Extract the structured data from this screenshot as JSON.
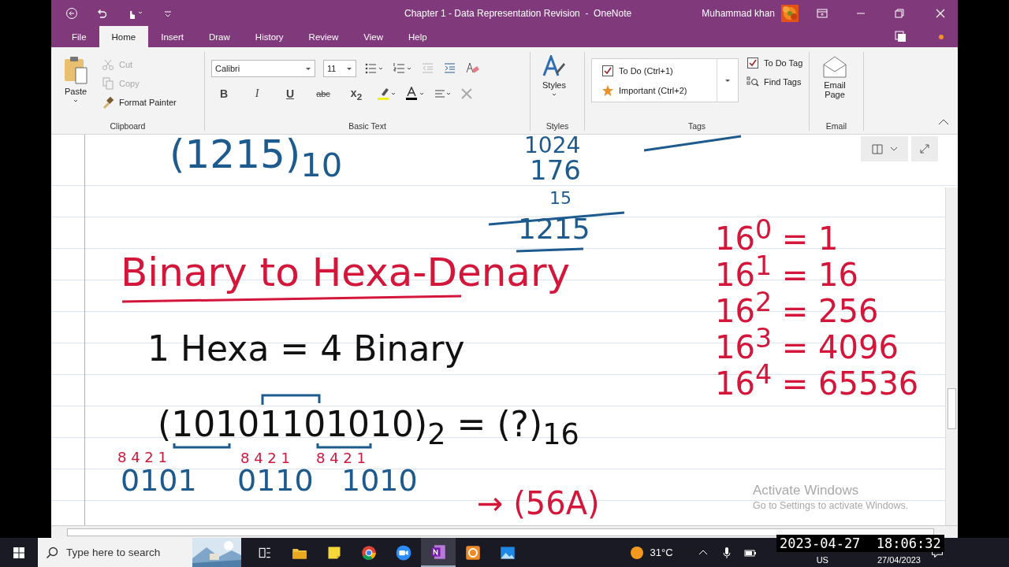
{
  "window": {
    "title": "Chapter 1 - Data Representation Revision  -  OneNote",
    "user": "Muhammad khan"
  },
  "ribbon_tabs": [
    {
      "label": "File",
      "selected": false
    },
    {
      "label": "Home",
      "selected": true
    },
    {
      "label": "Insert",
      "selected": false
    },
    {
      "label": "Draw",
      "selected": false
    },
    {
      "label": "History",
      "selected": false
    },
    {
      "label": "Review",
      "selected": false
    },
    {
      "label": "View",
      "selected": false
    },
    {
      "label": "Help",
      "selected": false
    }
  ],
  "clipboard": {
    "label": "Clipboard",
    "paste": "Paste",
    "items": [
      {
        "kind": "cut",
        "label": "Cut",
        "disabled": true
      },
      {
        "kind": "copy",
        "label": "Copy",
        "disabled": true
      },
      {
        "kind": "painter",
        "label": "Format Painter",
        "disabled": false
      }
    ]
  },
  "basic_text": {
    "label": "Basic Text",
    "font": "Calibri",
    "size": "11",
    "format_buttons": [
      {
        "kind": "bold",
        "label": "B"
      },
      {
        "kind": "italic",
        "label": "I"
      },
      {
        "kind": "underline",
        "label": "U"
      },
      {
        "kind": "strike",
        "label": "abc"
      },
      {
        "kind": "subscript",
        "label": "x$_{2}$"
      }
    ]
  },
  "styles": {
    "label": "Styles",
    "button": "Styles"
  },
  "tags": {
    "label": "Tags",
    "gallery": [
      {
        "kind": "todo",
        "label": "To Do (Ctrl+1)"
      },
      {
        "kind": "important",
        "label": "Important (Ctrl+2)"
      }
    ],
    "todo_tag": "To Do Tag",
    "find_tags": "Find Tags"
  },
  "email": {
    "label": "Email",
    "button": "Email Page"
  },
  "ink": [
    {
      "text": "(1215)$_{10}$",
      "color": "#1d5a8e"
    },
    {
      "text": "1024",
      "color": "#1d5a8e"
    },
    {
      "text": "176",
      "color": "#1d5a8e"
    },
    {
      "text": "15",
      "color": "#1d5a8e"
    },
    {
      "text": "1215",
      "color": "#1d5a8e"
    },
    {
      "text": "Binary to Hexa-Denary",
      "color": "#d4163a"
    },
    {
      "text": "1 Hexa = 4 Binary",
      "color": "#111111"
    },
    {
      "text": "(10101101010)$_{2}$ = (?)$_{16}$",
      "color": "#111111"
    },
    {
      "text": "8 4 2 1",
      "color": "#d4163a"
    },
    {
      "text": "8 4 2 1",
      "color": "#d4163a"
    },
    {
      "text": "8 4 2 1",
      "color": "#d4163a"
    },
    {
      "text": "0101",
      "color": "#1d5a8e"
    },
    {
      "text": "0110",
      "color": "#1d5a8e"
    },
    {
      "text": "1010",
      "color": "#1d5a8e"
    },
    {
      "text": "→ (56A)",
      "color": "#d4163a"
    },
    {
      "text": "16$^{0}$ = 1",
      "color": "#d4163a"
    },
    {
      "text": "16$^{1}$ = 16",
      "color": "#d4163a"
    },
    {
      "text": "16$^{2}$ = 256",
      "color": "#d4163a"
    },
    {
      "text": "16$^{3}$ = 4096",
      "color": "#d4163a"
    },
    {
      "text": "16$^{4}$ = 65536",
      "color": "#d4163a"
    }
  ],
  "activation": {
    "title": "Activate Windows",
    "hint": "Go to Settings to activate Windows."
  },
  "taskbar": {
    "search_placeholder": "Type here to search",
    "apps": [
      {
        "kind": "taskview",
        "selected": false
      },
      {
        "kind": "folder",
        "selected": false
      },
      {
        "kind": "note",
        "selected": false
      },
      {
        "kind": "browser",
        "selected": false
      },
      {
        "kind": "video",
        "selected": false
      },
      {
        "kind": "notebook",
        "selected": true
      },
      {
        "kind": "slides",
        "selected": false
      },
      {
        "kind": "photos",
        "selected": false
      }
    ],
    "weather": "31°C",
    "language": "US",
    "date": "27/04/2023"
  },
  "recording_timestamp": "2023-04-27  18:06:32"
}
